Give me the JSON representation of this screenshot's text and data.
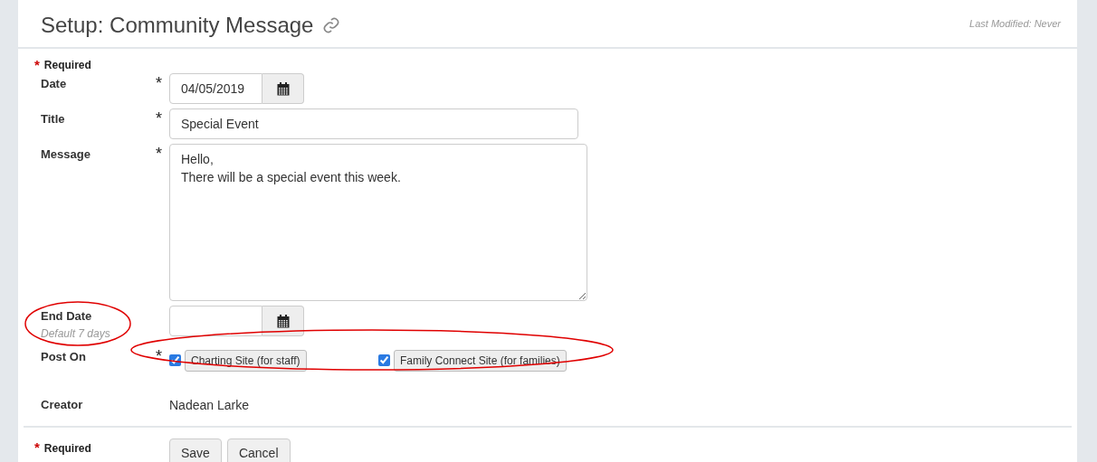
{
  "header": {
    "title": "Setup: Community Message",
    "last_modified": "Last Modified: Never"
  },
  "required_note": {
    "mark": "*",
    "text": "Required"
  },
  "fields": [
    {
      "kind": "date",
      "label": "Date",
      "required_mark": "*",
      "value": "04/05/2019"
    },
    {
      "kind": "text",
      "label": "Title",
      "required_mark": "*",
      "value": "Special Event"
    },
    {
      "kind": "textarea",
      "label": "Message",
      "required_mark": "*",
      "value": "Hello,\nThere will be a special event this week."
    },
    {
      "kind": "date",
      "label": "End Date",
      "hint": "Default 7 days"
    },
    {
      "kind": "checkboxes",
      "label": "Post On",
      "required_mark": "*",
      "options": [
        {
          "label": "Charting Site (for staff)",
          "checked": true
        },
        {
          "label": "Family Connect Site (for families)",
          "checked": true
        }
      ]
    },
    {
      "kind": "static",
      "label": "Creator",
      "value": "Nadean Larke"
    }
  ],
  "footer": {
    "required_note": {
      "mark": "*",
      "text": "Required"
    },
    "buttons": [
      "Save",
      "Cancel"
    ]
  },
  "annotations": [
    {
      "kind": "ellipse",
      "color": "#e00000"
    },
    {
      "kind": "ellipse",
      "color": "#e00000"
    }
  ]
}
